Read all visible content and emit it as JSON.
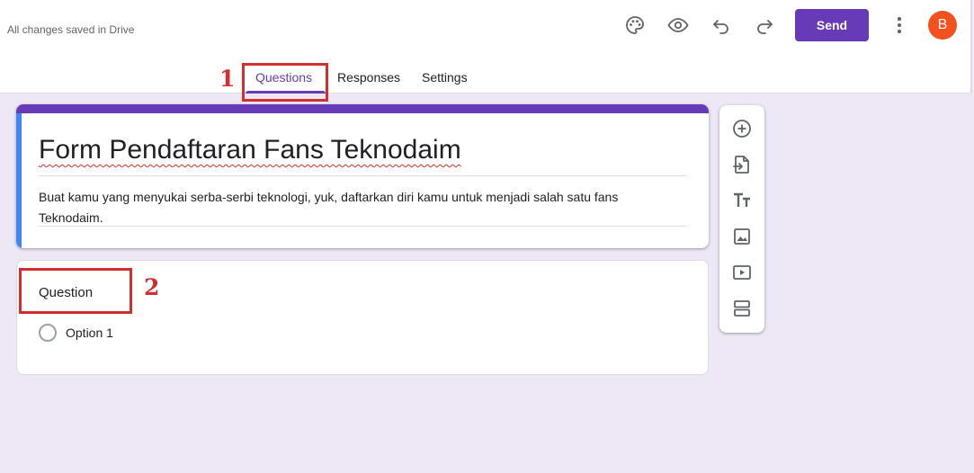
{
  "header": {
    "save_status": "All changes saved in Drive",
    "icons": [
      "palette-icon",
      "eye-icon",
      "undo-icon",
      "redo-icon"
    ],
    "send_label": "Send",
    "avatar_initial": "B",
    "more_icon": "more-vert-icon"
  },
  "tabs": [
    {
      "label": "Questions",
      "active": true
    },
    {
      "label": "Responses",
      "active": false
    },
    {
      "label": "Settings",
      "active": false
    }
  ],
  "annotations": [
    {
      "number": "1"
    },
    {
      "number": "2"
    }
  ],
  "form": {
    "title": "Form Pendaftaran Fans Teknodaim",
    "description": "Buat kamu yang menyukai serba-serbi teknologi, yuk, daftarkan diri kamu untuk menjadi salah satu fans Teknodaim."
  },
  "question": {
    "title": "Question",
    "options": [
      "Option 1"
    ]
  },
  "toolbar": {
    "tools": [
      "add-question-icon",
      "import-questions-icon",
      "add-title-icon",
      "add-image-icon",
      "add-video-icon",
      "add-section-icon"
    ]
  },
  "colors": {
    "accent": "#673ab7",
    "background": "#ede7f6",
    "annotation": "#d32f2f",
    "title_left_strip": "#4285f4",
    "avatar": "#f4511e"
  }
}
